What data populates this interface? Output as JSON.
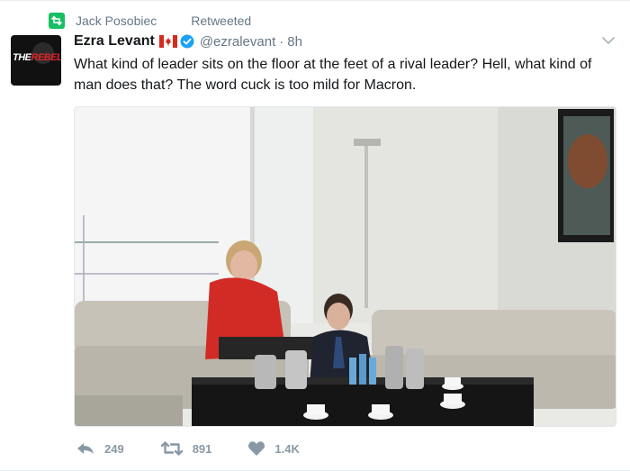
{
  "retweet_context": {
    "icon": "retweet-icon",
    "name": "Jack Posobiec",
    "label": "Retweeted",
    "color": "#17bf63"
  },
  "author": {
    "avatar_text_white": "THE",
    "avatar_text_red": "REBEL",
    "display_name": "Ezra Levant",
    "flag_icon": "canada-flag-icon",
    "verified_icon": "verified-badge-icon",
    "handle": "@ezralevant",
    "separator": "·",
    "time": "8h"
  },
  "tweet": {
    "text": "What kind of leader sits on the floor at the feet of a rival leader? Hell, what kind of man does that? The word cuck is too mild for Macron."
  },
  "actions": {
    "reply": {
      "icon": "reply-icon",
      "count": "249"
    },
    "retweet": {
      "icon": "retweet-icon",
      "count": "891"
    },
    "like": {
      "icon": "heart-icon",
      "count": "1.4K"
    }
  },
  "colors": {
    "text": "#14171a",
    "secondary": "#657786",
    "action": "#8899a6",
    "verified": "#1da1f2",
    "flag_red": "#d52b1e"
  }
}
